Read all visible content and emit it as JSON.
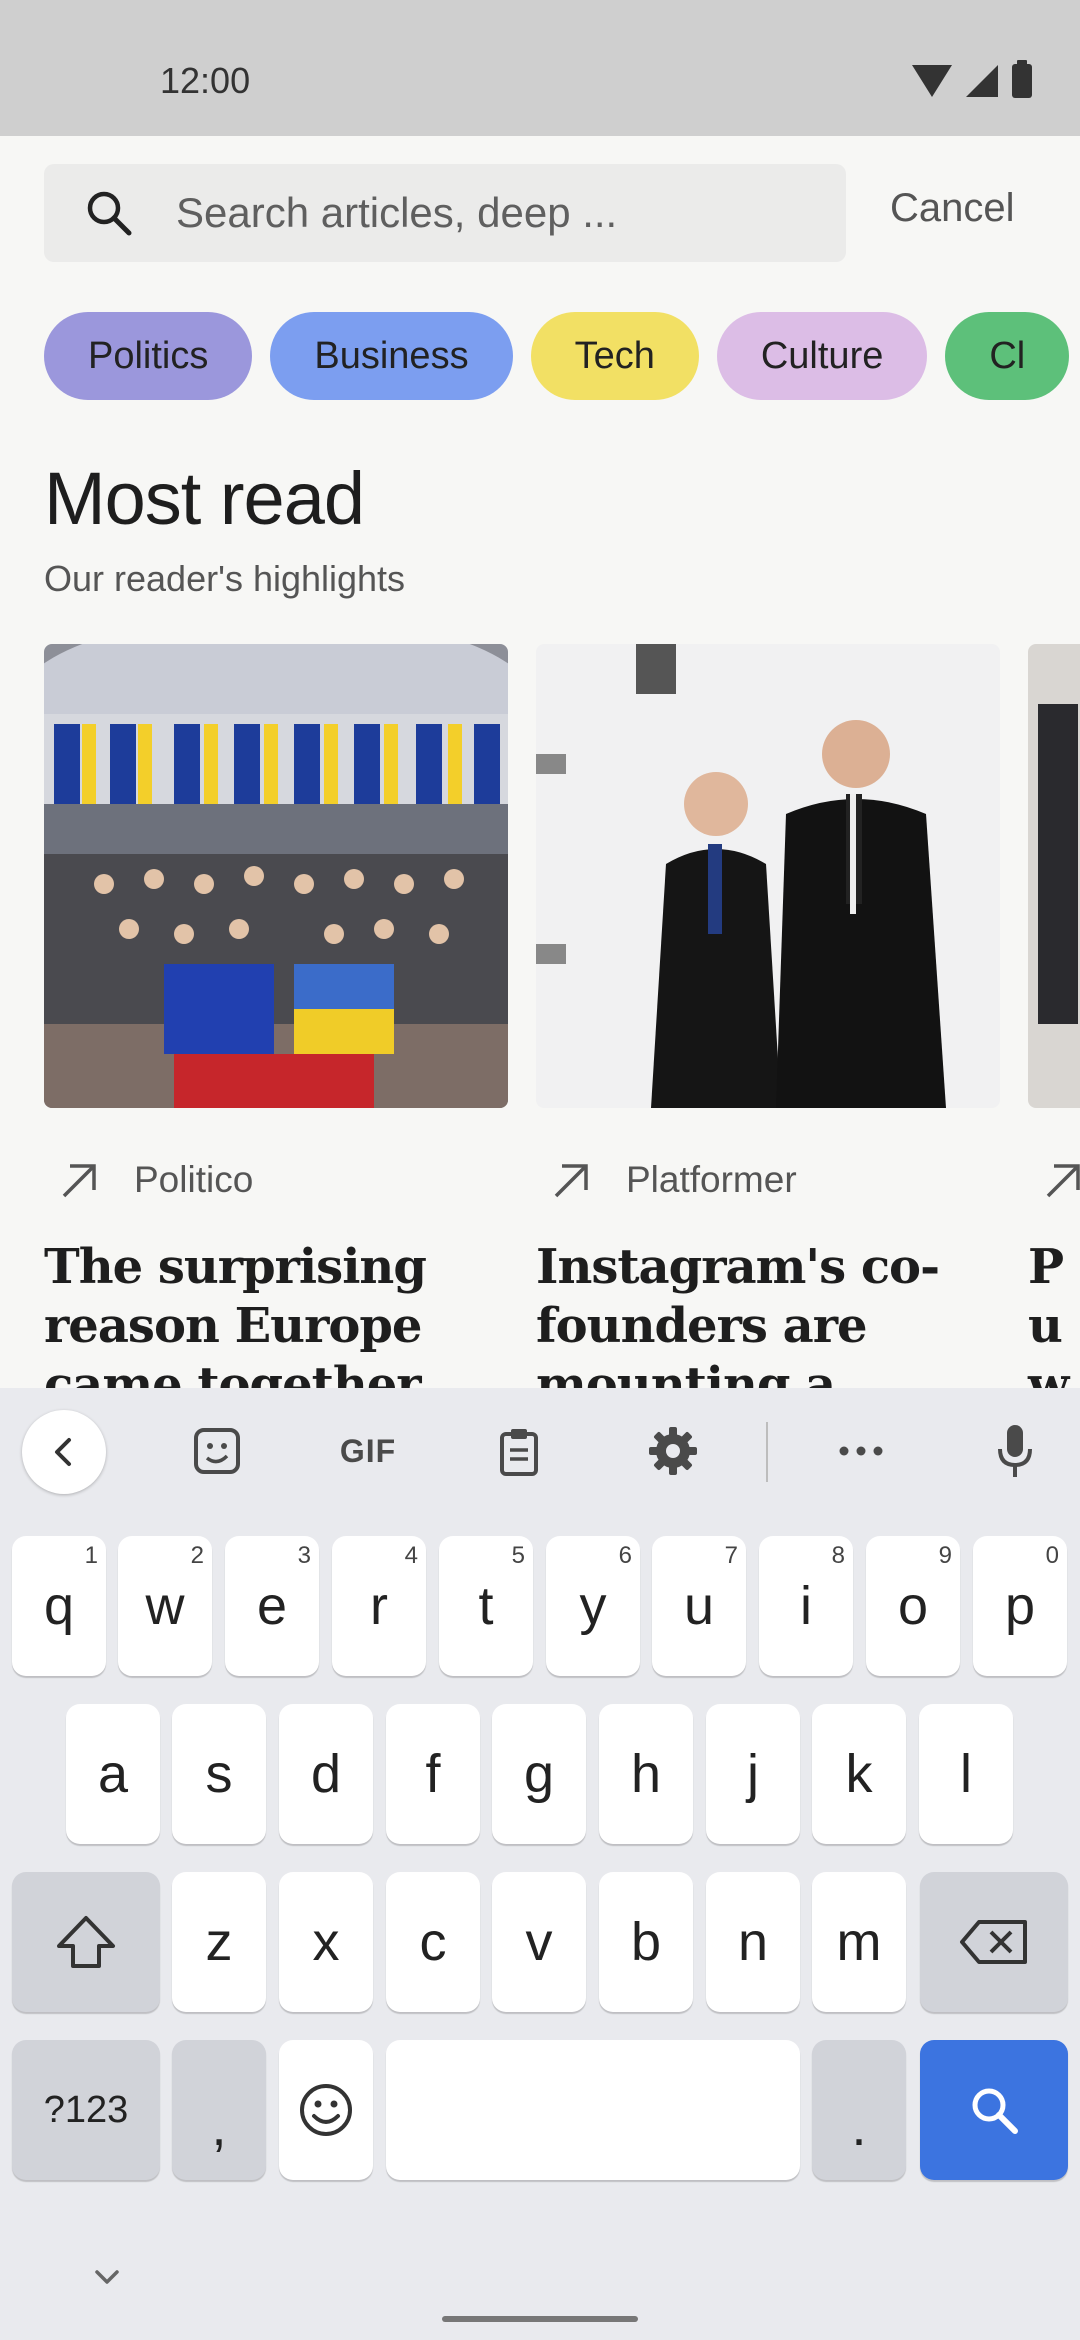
{
  "status_bar": {
    "time": "12:00"
  },
  "search": {
    "placeholder": "Search articles, deep ...",
    "cancel_label": "Cancel"
  },
  "chips": [
    {
      "label": "Politics",
      "color": "#9b97dc"
    },
    {
      "label": "Business",
      "color": "#7c9ef0"
    },
    {
      "label": "Tech",
      "color": "#f2e064"
    },
    {
      "label": "Culture",
      "color": "#dcbde6"
    },
    {
      "label": "Cl",
      "color": "#5dc07a"
    }
  ],
  "section": {
    "title": "Most read",
    "subtitle": "Our reader's highlights"
  },
  "cards": [
    {
      "source": "Politico",
      "headline": "The surprising reason Europe came together"
    },
    {
      "source": "Platformer",
      "headline": "Instagram's co-founders are mounting a"
    },
    {
      "source": "",
      "headline": "Pu we Go"
    }
  ],
  "keyboard": {
    "toolbar": [
      "back",
      "sticker",
      "GIF",
      "clipboard",
      "settings",
      "more",
      "mic"
    ],
    "gif_label": "GIF",
    "row1": [
      {
        "key": "q",
        "hint": "1"
      },
      {
        "key": "w",
        "hint": "2"
      },
      {
        "key": "e",
        "hint": "3"
      },
      {
        "key": "r",
        "hint": "4"
      },
      {
        "key": "t",
        "hint": "5"
      },
      {
        "key": "y",
        "hint": "6"
      },
      {
        "key": "u",
        "hint": "7"
      },
      {
        "key": "i",
        "hint": "8"
      },
      {
        "key": "o",
        "hint": "9"
      },
      {
        "key": "p",
        "hint": "0"
      }
    ],
    "row2": [
      "a",
      "s",
      "d",
      "f",
      "g",
      "h",
      "j",
      "k",
      "l"
    ],
    "row3": [
      "z",
      "x",
      "c",
      "v",
      "b",
      "n",
      "m"
    ],
    "symbols_label": "?123",
    "comma_label": ",",
    "period_label": ".",
    "accent_color": "#3c74e0"
  }
}
